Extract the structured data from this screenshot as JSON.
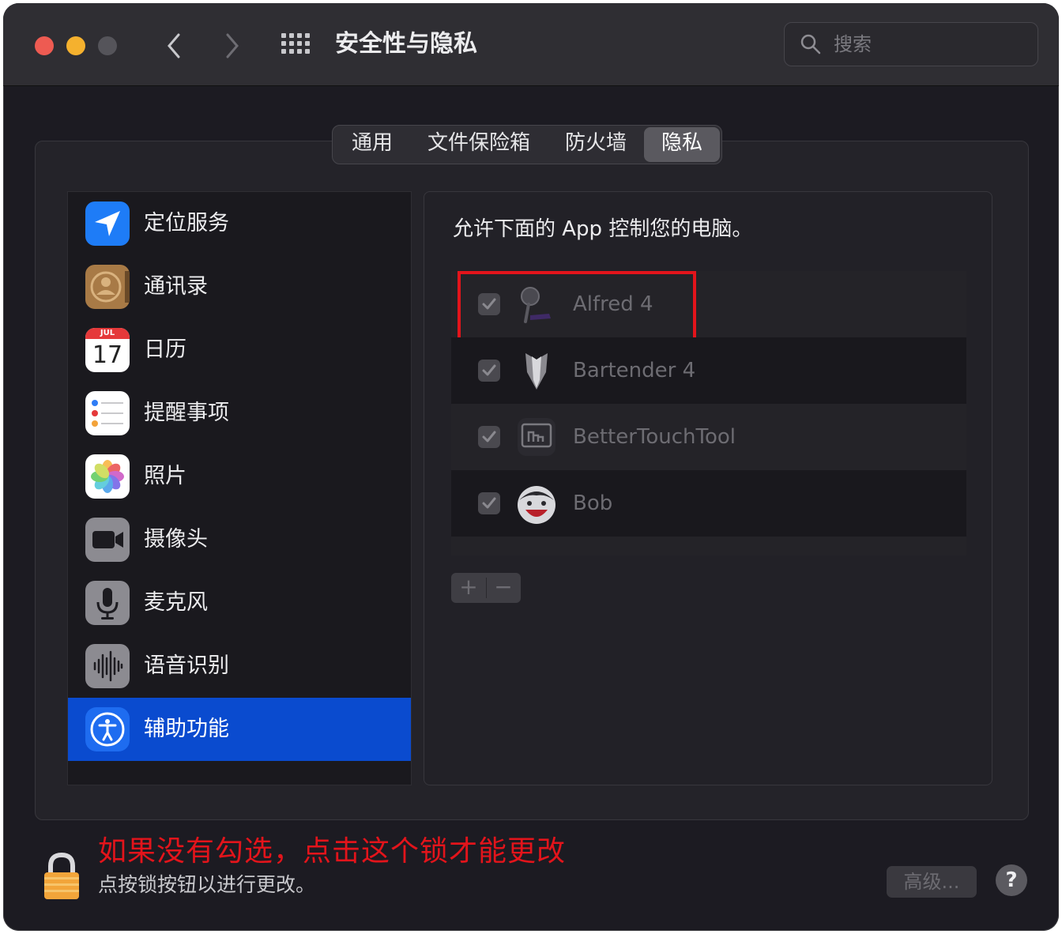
{
  "window": {
    "title": "安全性与隐私"
  },
  "search": {
    "placeholder": "搜索"
  },
  "tabs": [
    {
      "label": "通用",
      "active": false
    },
    {
      "label": "文件保险箱",
      "active": false
    },
    {
      "label": "防火墙",
      "active": false
    },
    {
      "label": "隐私",
      "active": true
    }
  ],
  "sidebar": {
    "items": [
      {
        "label": "定位服务",
        "icon": "location-arrow-icon"
      },
      {
        "label": "通讯录",
        "icon": "contacts-icon"
      },
      {
        "label": "日历",
        "icon": "calendar-icon",
        "month": "JUL",
        "day": "17"
      },
      {
        "label": "提醒事项",
        "icon": "reminders-icon"
      },
      {
        "label": "照片",
        "icon": "photos-icon"
      },
      {
        "label": "摄像头",
        "icon": "camera-icon"
      },
      {
        "label": "麦克风",
        "icon": "microphone-icon"
      },
      {
        "label": "语音识别",
        "icon": "speech-recognition-icon"
      },
      {
        "label": "辅助功能",
        "icon": "accessibility-icon",
        "selected": true
      }
    ]
  },
  "main": {
    "title": "允许下面的 App 控制您的电脑。",
    "apps": [
      {
        "name": "Alfred 4",
        "checked": true,
        "icon": "alfred-icon"
      },
      {
        "name": "Bartender 4",
        "checked": true,
        "icon": "bartender-icon"
      },
      {
        "name": "BetterTouchTool",
        "checked": true,
        "icon": "bettertouchtool-icon"
      },
      {
        "name": "Bob",
        "checked": true,
        "icon": "bob-icon"
      }
    ],
    "add_label": "+",
    "remove_label": "−"
  },
  "footer": {
    "annotation": "如果没有勾选，点击这个锁才能更改",
    "lock_hint": "点按锁按钮以进行更改。",
    "advanced_label": "高级...",
    "help_label": "?"
  },
  "colors": {
    "selection": "#0a4bcf",
    "annotation": "#e3141b"
  }
}
